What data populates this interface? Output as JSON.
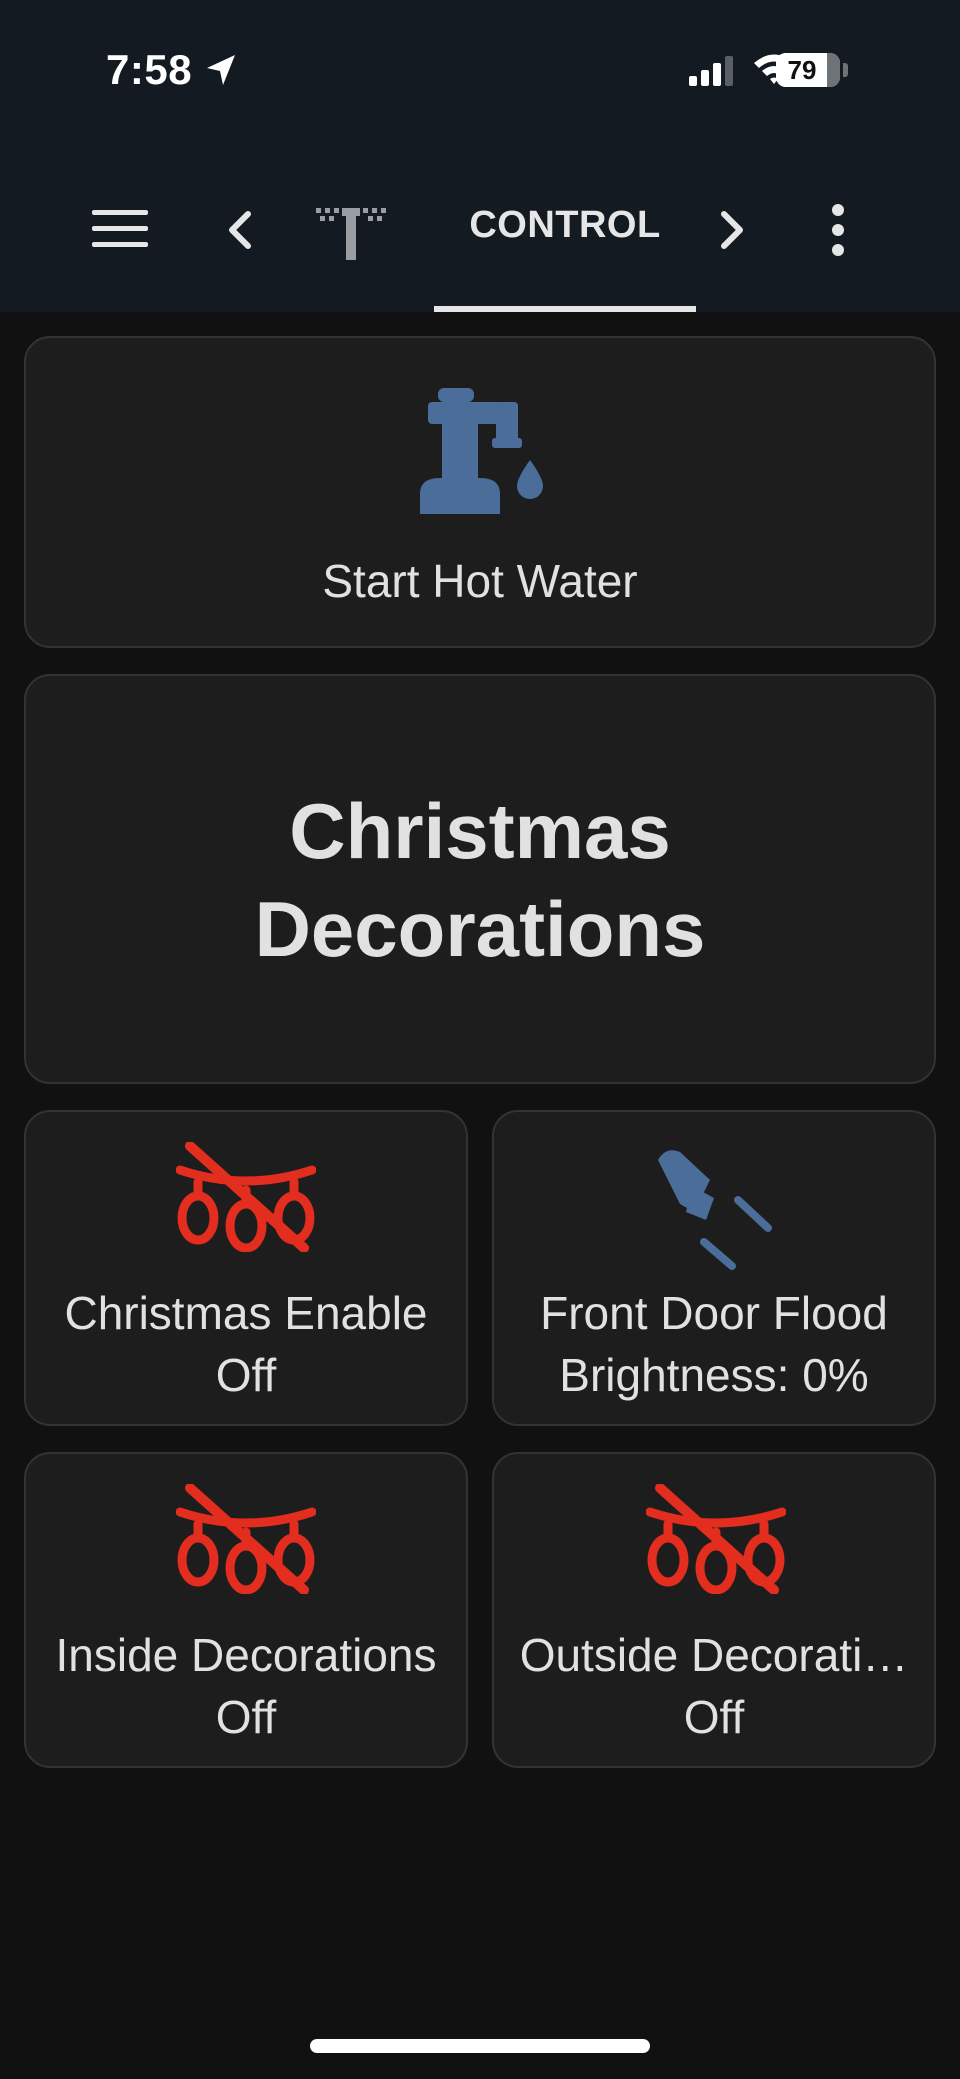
{
  "status_bar": {
    "time": "7:58",
    "battery": "79",
    "battery_level": 0.79,
    "icons": [
      "location-arrow-icon",
      "cellular-signal-icon",
      "wifi-icon",
      "battery-icon"
    ]
  },
  "toolbar": {
    "icons": [
      "hamburger-menu-icon",
      "chevron-left-icon",
      "sprinkler-icon",
      "chevron-right-icon",
      "more-vertical-icon"
    ],
    "active_tab": "CONTROL"
  },
  "colors": {
    "background": "#111111",
    "card": "#1d1d1d",
    "toolbar": "#141a22",
    "icon_on": "#4a6d9a",
    "icon_off": "#e32d1e",
    "text": "#e1e1e1"
  },
  "cards": {
    "hot_water": {
      "label": "Start Hot Water",
      "icon": "water-pump-icon"
    },
    "heading": {
      "line1": "Christmas",
      "line2": "Decorations"
    },
    "christmas_enable": {
      "name": "Christmas Enable",
      "state": "Off",
      "icon": "string-lights-off-icon"
    },
    "front_door_flood": {
      "name": "Front Door Flood",
      "state": "Brightness: 0%",
      "icon": "spotlight-beam-icon"
    },
    "inside_decorations": {
      "name": "Inside Decorations",
      "state": "Off",
      "icon": "string-lights-off-icon"
    },
    "outside_decorations": {
      "name": "Outside Decorati…",
      "state": "Off",
      "icon": "string-lights-off-icon"
    }
  }
}
